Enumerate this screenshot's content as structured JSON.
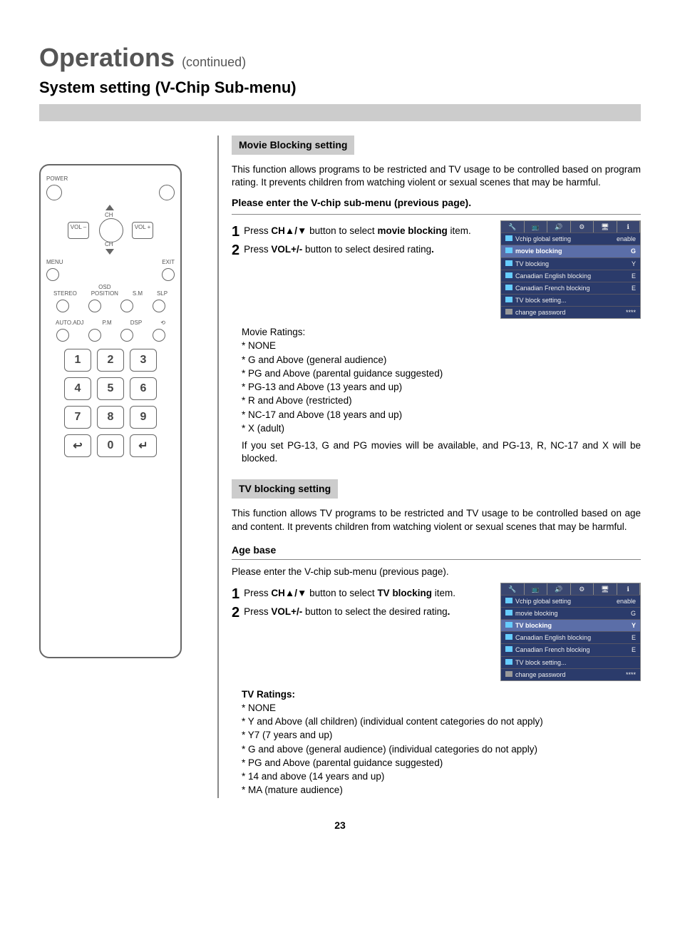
{
  "header": {
    "title": "Operations",
    "continued": "(continued)",
    "subtitle": "System setting (V-Chip Sub-menu)"
  },
  "remote": {
    "power": "POWER",
    "ch": "CH",
    "vol_minus": "VOL\n–",
    "vol_plus": "VOL\n+",
    "menu": "MENU",
    "exit": "EXIT",
    "stereo": "STEREO",
    "osd": "OSD\nPOSITION",
    "sm": "S.M",
    "slp": "SLP",
    "auto": "AUTO.ADJ",
    "pm": "P.M",
    "dsp": "DSP",
    "loop": "⟲",
    "num1": "1",
    "num2": "2",
    "num3": "3",
    "num4": "4",
    "num5": "5",
    "num6": "6",
    "num7": "7",
    "num8": "8",
    "num9": "9",
    "num0": "0",
    "recall": "↩",
    "enter": "↵"
  },
  "movie": {
    "heading": "Movie Blocking setting",
    "desc": "This function allows programs to be restricted and TV usage to be controlled based on program rating. It prevents children from watching violent or sexual scenes that may be harmful.",
    "enter": "Please enter the V-chip sub-menu (previous page).",
    "step1_a": "Press ",
    "step1_b": "CH▲/▼",
    "step1_c": " button to select ",
    "step1_d": "movie blocking",
    "step1_e": " item.",
    "step2_a": "Press ",
    "step2_b": "VOL+/-",
    "step2_c": " button to select desired rating",
    "period": ".",
    "ratings_title": "Movie Ratings:",
    "r0": "* NONE",
    "r1": "* G and Above (general audience)",
    "r2": "* PG and Above (parental guidance suggested)",
    "r3": "* PG-13 and Above (13 years and up)",
    "r4": "* R and Above (restricted)",
    "r5": "* NC-17 and Above (18 years and up)",
    "r6": "* X (adult)",
    "note": "If you set PG-13, G and PG movies will be available,  and PG-13, R, NC-17 and X will be blocked."
  },
  "tv": {
    "heading": "TV blocking setting",
    "desc": "This function allows TV programs to be restricted and TV usage to be controlled based on age and content. It prevents children from watching violent or sexual scenes that may be harmful.",
    "agebase": "Age base",
    "enter": "Please enter the V-chip sub-menu (previous page).",
    "step1_a": "Press ",
    "step1_b": "CH▲/▼",
    "step1_c": " button to select ",
    "step1_d": "TV blocking",
    "step1_e": " item.",
    "step2_a": "Press ",
    "step2_b": "VOL+/-",
    "step2_c": " button to select the desired rating",
    "period": ".",
    "ratings_title": "TV Ratings:",
    "r0": "* NONE",
    "r1": "* Y and Above (all children) (individual content categories do not apply)",
    "r2": "* Y7 (7 years and up)",
    "r3": "* G and above (general audience) (individual categories do not apply)",
    "r4": "* PG and Above (parental guidance suggested)",
    "r5": "* 14 and above (14 years and up)",
    "r6": "* MA  (mature audience)"
  },
  "osd": {
    "rows": {
      "vchip_label": "Vchip global setting",
      "vchip_val": "enable",
      "movie_label": "movie blocking",
      "movie_val": "G",
      "tv_label": "TV blocking",
      "tv_val": "Y",
      "ceng_label": "Canadian English blocking",
      "ceng_val": "E",
      "cfr_label": "Canadian French blocking",
      "cfr_val": "E",
      "tvset_label": "TV block setting...",
      "tvset_val": "",
      "pwd_label": "change password",
      "pwd_val": "****"
    }
  },
  "page": "23"
}
